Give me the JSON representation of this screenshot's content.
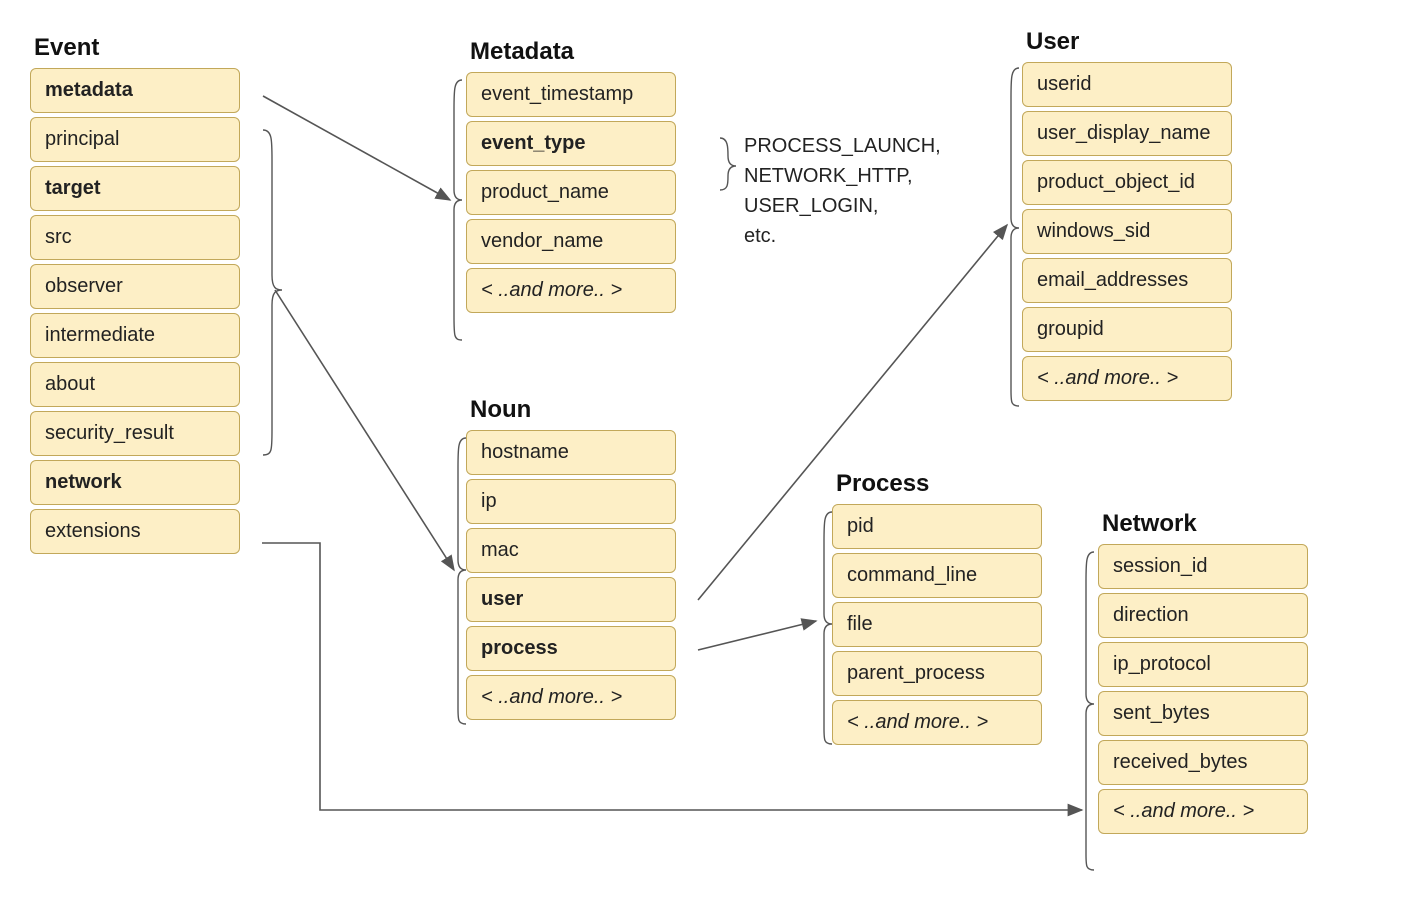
{
  "entities": {
    "event": {
      "title": "Event",
      "fields": [
        {
          "label": "metadata",
          "bold": true
        },
        {
          "label": "principal"
        },
        {
          "label": "target",
          "bold": true
        },
        {
          "label": "src"
        },
        {
          "label": "observer"
        },
        {
          "label": "intermediate"
        },
        {
          "label": "about"
        },
        {
          "label": "security_result"
        },
        {
          "label": "network",
          "bold": true
        },
        {
          "label": "extensions"
        }
      ]
    },
    "metadata": {
      "title": "Metadata",
      "fields": [
        {
          "label": "event_timestamp"
        },
        {
          "label": "event_type",
          "bold": true
        },
        {
          "label": "product_name"
        },
        {
          "label": "vendor_name"
        },
        {
          "label": "< ..and more.. >",
          "italic": true
        }
      ]
    },
    "noun": {
      "title": "Noun",
      "fields": [
        {
          "label": "hostname"
        },
        {
          "label": "ip"
        },
        {
          "label": "mac"
        },
        {
          "label": "user",
          "bold": true
        },
        {
          "label": "process",
          "bold": true
        },
        {
          "label": "< ..and more.. >",
          "italic": true
        }
      ]
    },
    "user": {
      "title": "User",
      "fields": [
        {
          "label": "userid"
        },
        {
          "label": "user_display_name"
        },
        {
          "label": "product_object_id"
        },
        {
          "label": "windows_sid"
        },
        {
          "label": "email_addresses"
        },
        {
          "label": "groupid"
        },
        {
          "label": "< ..and more.. >",
          "italic": true
        }
      ]
    },
    "process": {
      "title": "Process",
      "fields": [
        {
          "label": "pid"
        },
        {
          "label": "command_line"
        },
        {
          "label": "file"
        },
        {
          "label": "parent_process"
        },
        {
          "label": "< ..and more.. >",
          "italic": true
        }
      ]
    },
    "network": {
      "title": "Network",
      "fields": [
        {
          "label": "session_id"
        },
        {
          "label": "direction"
        },
        {
          "label": "ip_protocol"
        },
        {
          "label": "sent_bytes"
        },
        {
          "label": "received_bytes"
        },
        {
          "label": "< ..and more.. >",
          "italic": true
        }
      ]
    }
  },
  "annotation": {
    "lines": [
      "PROCESS_LAUNCH,",
      "NETWORK_HTTP,",
      "USER_LOGIN,",
      "etc."
    ]
  }
}
